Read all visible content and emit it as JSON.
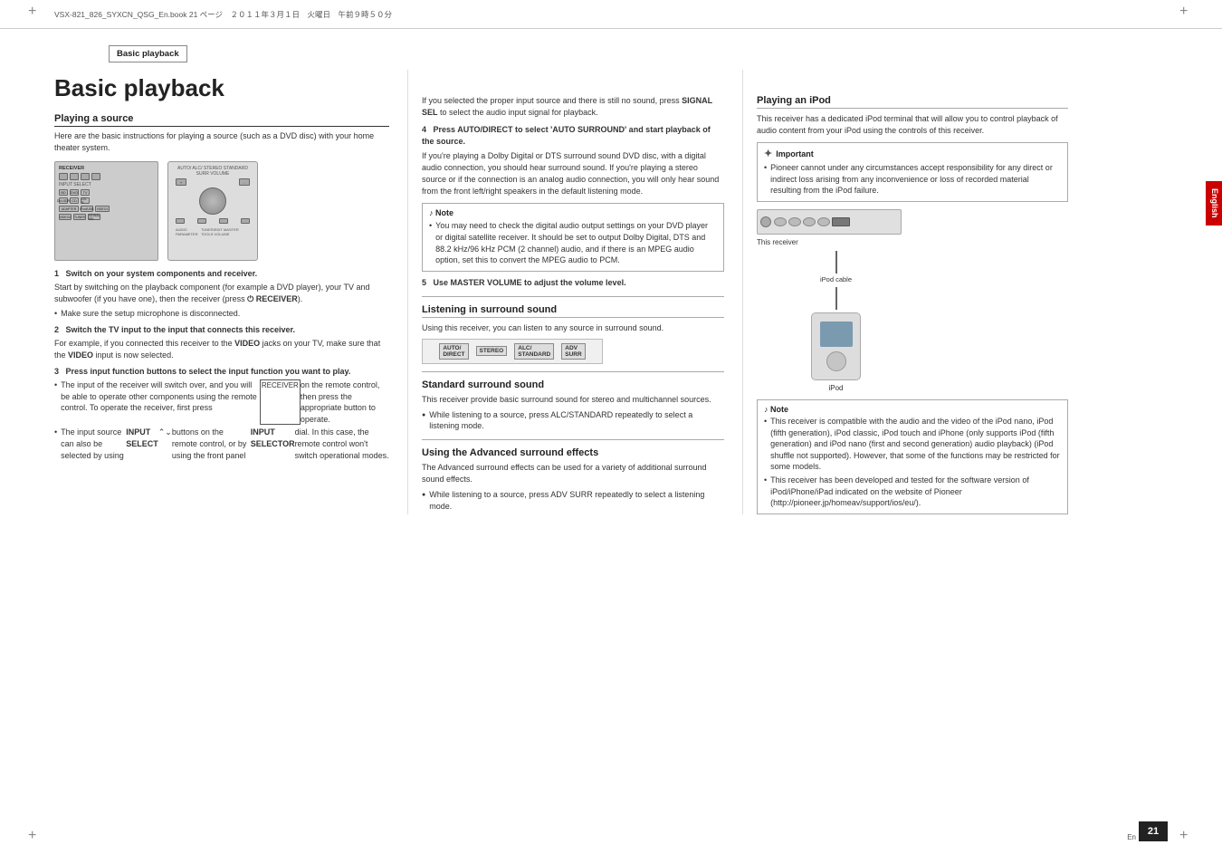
{
  "page": {
    "number": "21",
    "lang": "En",
    "section_label": "Basic playback",
    "main_title": "Basic playback",
    "header_meta": "VSX-821_826_SYXCN_QSG_En.book   21 ページ　２０１１年３月１日　火曜日　午前９時５０分"
  },
  "left_col": {
    "title": "Playing a source",
    "intro": "Here are the basic instructions for playing a source (such as a DVD disc) with your home theater system.",
    "steps": [
      {
        "num": "1",
        "heading": "Switch on your system components and receiver.",
        "text": "Start by switching on the playback component (for example a DVD player), your TV and subwoofer (if you have one), then the receiver (press  RECEIVER).",
        "bullets": [
          "Make sure the setup microphone is disconnected."
        ]
      },
      {
        "num": "2",
        "heading": "Switch the TV input to the input that connects this receiver.",
        "text": "For example, if you connected this receiver to the VIDEO jacks on your TV, make sure that the VIDEO input is now selected."
      },
      {
        "num": "3",
        "heading": "Press input function buttons to select the input function you want to play.",
        "bullets": [
          "The input of the receiver will switch over, and you will be able to operate other components using the remote control. To operate the receiver, first press RECEIVER on the remote control, then press the appropriate button to operate.",
          "The input source can also be selected by using INPUT SELECT buttons on the remote control, or by using the front panel INPUT SELECTOR dial. In this case, the remote control won't switch operational modes."
        ]
      }
    ]
  },
  "mid_col": {
    "cont_text": "If you selected the proper input source and there is still no sound, press SIGNAL SEL to select the audio input signal for playback.",
    "step4": {
      "num": "4",
      "heading": "Press AUTO/DIRECT to select 'AUTO SURROUND' and start playback of the source.",
      "text": "If you're playing a Dolby Digital or DTS surround sound DVD disc, with a digital audio connection, you should hear surround sound. If you're playing a stereo source or if the connection is an analog audio connection, you will only hear sound from the front left/right speakers in the default listening mode."
    },
    "note1": {
      "title": "Note",
      "text": "You may need to check the digital audio output settings on your DVD player or digital satellite receiver. It should be set to output Dolby Digital, DTS and 88.2 kHz/96 kHz PCM (2 channel) audio, and if there is an MPEG audio option, set this to convert the MPEG audio to PCM."
    },
    "step5": {
      "num": "5",
      "heading": "Use MASTER VOLUME to adjust the volume level."
    },
    "listening_title": "Listening in surround sound",
    "listening_text": "Using this receiver, you can listen to any source in surround sound.",
    "standard_title": "Standard surround sound",
    "standard_text": "This receiver provide basic surround sound for stereo and multichannel sources.",
    "standard_bullet": "While listening to a source, press ALC/STANDARD repeatedly to select a listening mode.",
    "advanced_title": "Using the Advanced surround effects",
    "advanced_text": "The Advanced surround effects can be used for a variety of additional surround sound effects.",
    "advanced_bullet": "While listening to a source, press ADV SURR repeatedly to select a listening mode."
  },
  "right_col": {
    "ipod_title": "Playing an iPod",
    "ipod_text": "This receiver has a dedicated iPod terminal that will allow you to control playback of audio content from your iPod using the controls of this receiver.",
    "important_title": "Important",
    "important_bullets": [
      "Pioneer cannot under any circumstances accept responsibility for any direct or indirect loss arising from any inconvenience or loss of recorded material resulting from the iPod failure."
    ],
    "diagram_labels": {
      "receiver": "This receiver",
      "cable": "iPod cable",
      "ipod": "iPod"
    },
    "note2_title": "Note",
    "note2_bullets": [
      "This receiver is compatible with the audio and the video of the iPod nano, iPod (fifth generation), iPod classic, iPod touch and iPhone (only supports iPod (fifth generation) and iPod nano (first and second generation) audio playback) (iPod shuffle not supported). However, that some of the functions may be restricted for some models.",
      "This receiver has been developed and tested for the software version of iPod/iPhone/iPad indicated on the website of Pioneer (http://pioneer.jp/homeav/support/ios/eu/)."
    ]
  },
  "english_tab": "English",
  "alc_bar": {
    "buttons": [
      "AUTO/DIRECT",
      "STEREO",
      "ALC/STANDARD",
      "ADV SURR"
    ]
  }
}
